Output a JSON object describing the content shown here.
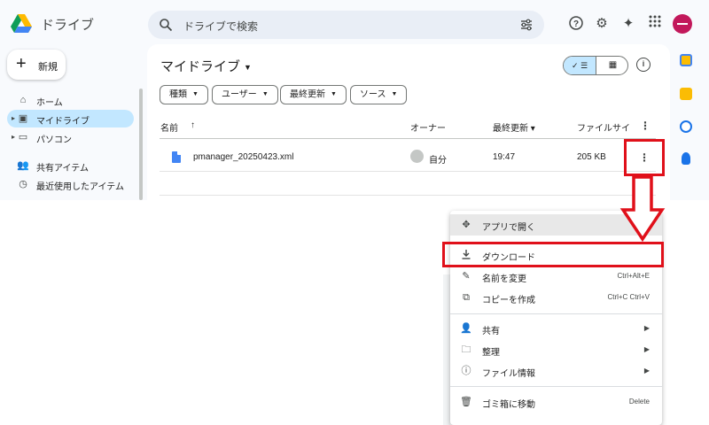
{
  "app": {
    "title": "ドライブ",
    "search_placeholder": "ドライブで検索"
  },
  "header_icons": [
    "help-icon",
    "settings-icon",
    "gemini-sparkle-icon",
    "apps-grid-icon"
  ],
  "new_button": {
    "label": "新規"
  },
  "sidebar": {
    "items": [
      {
        "label": "ホーム",
        "icon": "home-icon"
      },
      {
        "label": "マイドライブ",
        "icon": "drive-icon",
        "active": true
      },
      {
        "label": "パソコン",
        "icon": "computer-icon"
      },
      {
        "label": "共有アイテム",
        "icon": "people-icon"
      },
      {
        "label": "最近使用したアイテム",
        "icon": "clock-icon"
      }
    ]
  },
  "main": {
    "title": "マイドライブ",
    "filters": [
      "種類",
      "ユーザー",
      "最終更新",
      "ソース"
    ],
    "columns": {
      "name": "名前",
      "owner": "オーナー",
      "modified": "最終更新",
      "size": "ファイルサイ"
    },
    "rows": [
      {
        "name": "pmanager_20250423.xml",
        "owner": "自分",
        "modified": "19:47",
        "size": "205 KB"
      }
    ]
  },
  "context_menu": {
    "items": [
      {
        "label": "アプリで開く",
        "icon": "open-with-icon",
        "submenu": true
      },
      {
        "label": "ダウンロード",
        "icon": "download-icon",
        "highlighted": true
      },
      {
        "label": "名前を変更",
        "icon": "rename-icon",
        "shortcut": "Ctrl+Alt+E"
      },
      {
        "label": "コピーを作成",
        "icon": "copy-icon",
        "shortcut": "Ctrl+C Ctrl+V"
      },
      {
        "label": "共有",
        "icon": "share-icon",
        "submenu": true
      },
      {
        "label": "整理",
        "icon": "folder-icon",
        "submenu": true
      },
      {
        "label": "ファイル情報",
        "icon": "info-icon",
        "submenu": true
      },
      {
        "label": "ゴミ箱に移動",
        "icon": "trash-icon",
        "shortcut": "Delete"
      }
    ]
  },
  "colors": {
    "accent": "#c2e7ff",
    "annotation": "#e0101a",
    "file_icon": "#4285f4",
    "avatar": "#c2185b"
  }
}
